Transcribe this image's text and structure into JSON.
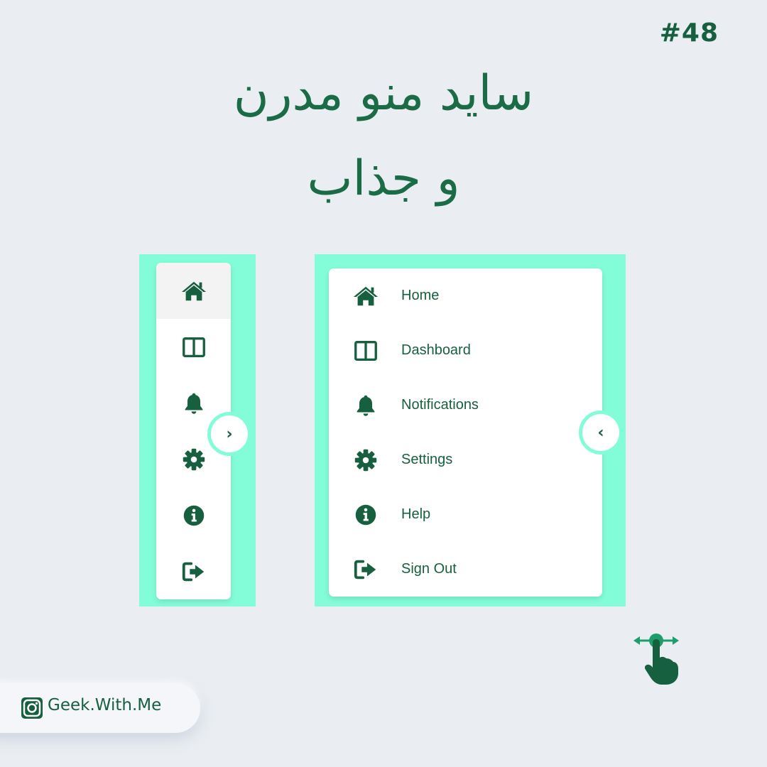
{
  "post_number": "#48",
  "title": {
    "line1": "ساید منو مدرن",
    "line2": "و جذاب"
  },
  "colors": {
    "background": "#eaeef2",
    "accent": "#83fdd8",
    "primary_text": "#17603f",
    "menu_bg": "#ffffff"
  },
  "collapsed_menu": {
    "items": [
      {
        "icon": "home-icon",
        "active": true
      },
      {
        "icon": "dashboard-icon"
      },
      {
        "icon": "bell-icon"
      },
      {
        "icon": "gear-icon"
      },
      {
        "icon": "info-icon"
      },
      {
        "icon": "sign-out-icon"
      }
    ],
    "toggle_glyph": "›"
  },
  "expanded_menu": {
    "items": [
      {
        "icon": "home-icon",
        "label": "Home"
      },
      {
        "icon": "dashboard-icon",
        "label": "Dashboard"
      },
      {
        "icon": "bell-icon",
        "label": "Notifications"
      },
      {
        "icon": "gear-icon",
        "label": "Settings"
      },
      {
        "icon": "info-icon",
        "label": "Help"
      },
      {
        "icon": "sign-out-icon",
        "label": "Sign Out"
      }
    ],
    "toggle_glyph": "‹"
  },
  "footer": {
    "icon": "instagram-icon",
    "handle": "Geek.With.Me"
  },
  "swipe_icon": "swipe-hand-icon"
}
